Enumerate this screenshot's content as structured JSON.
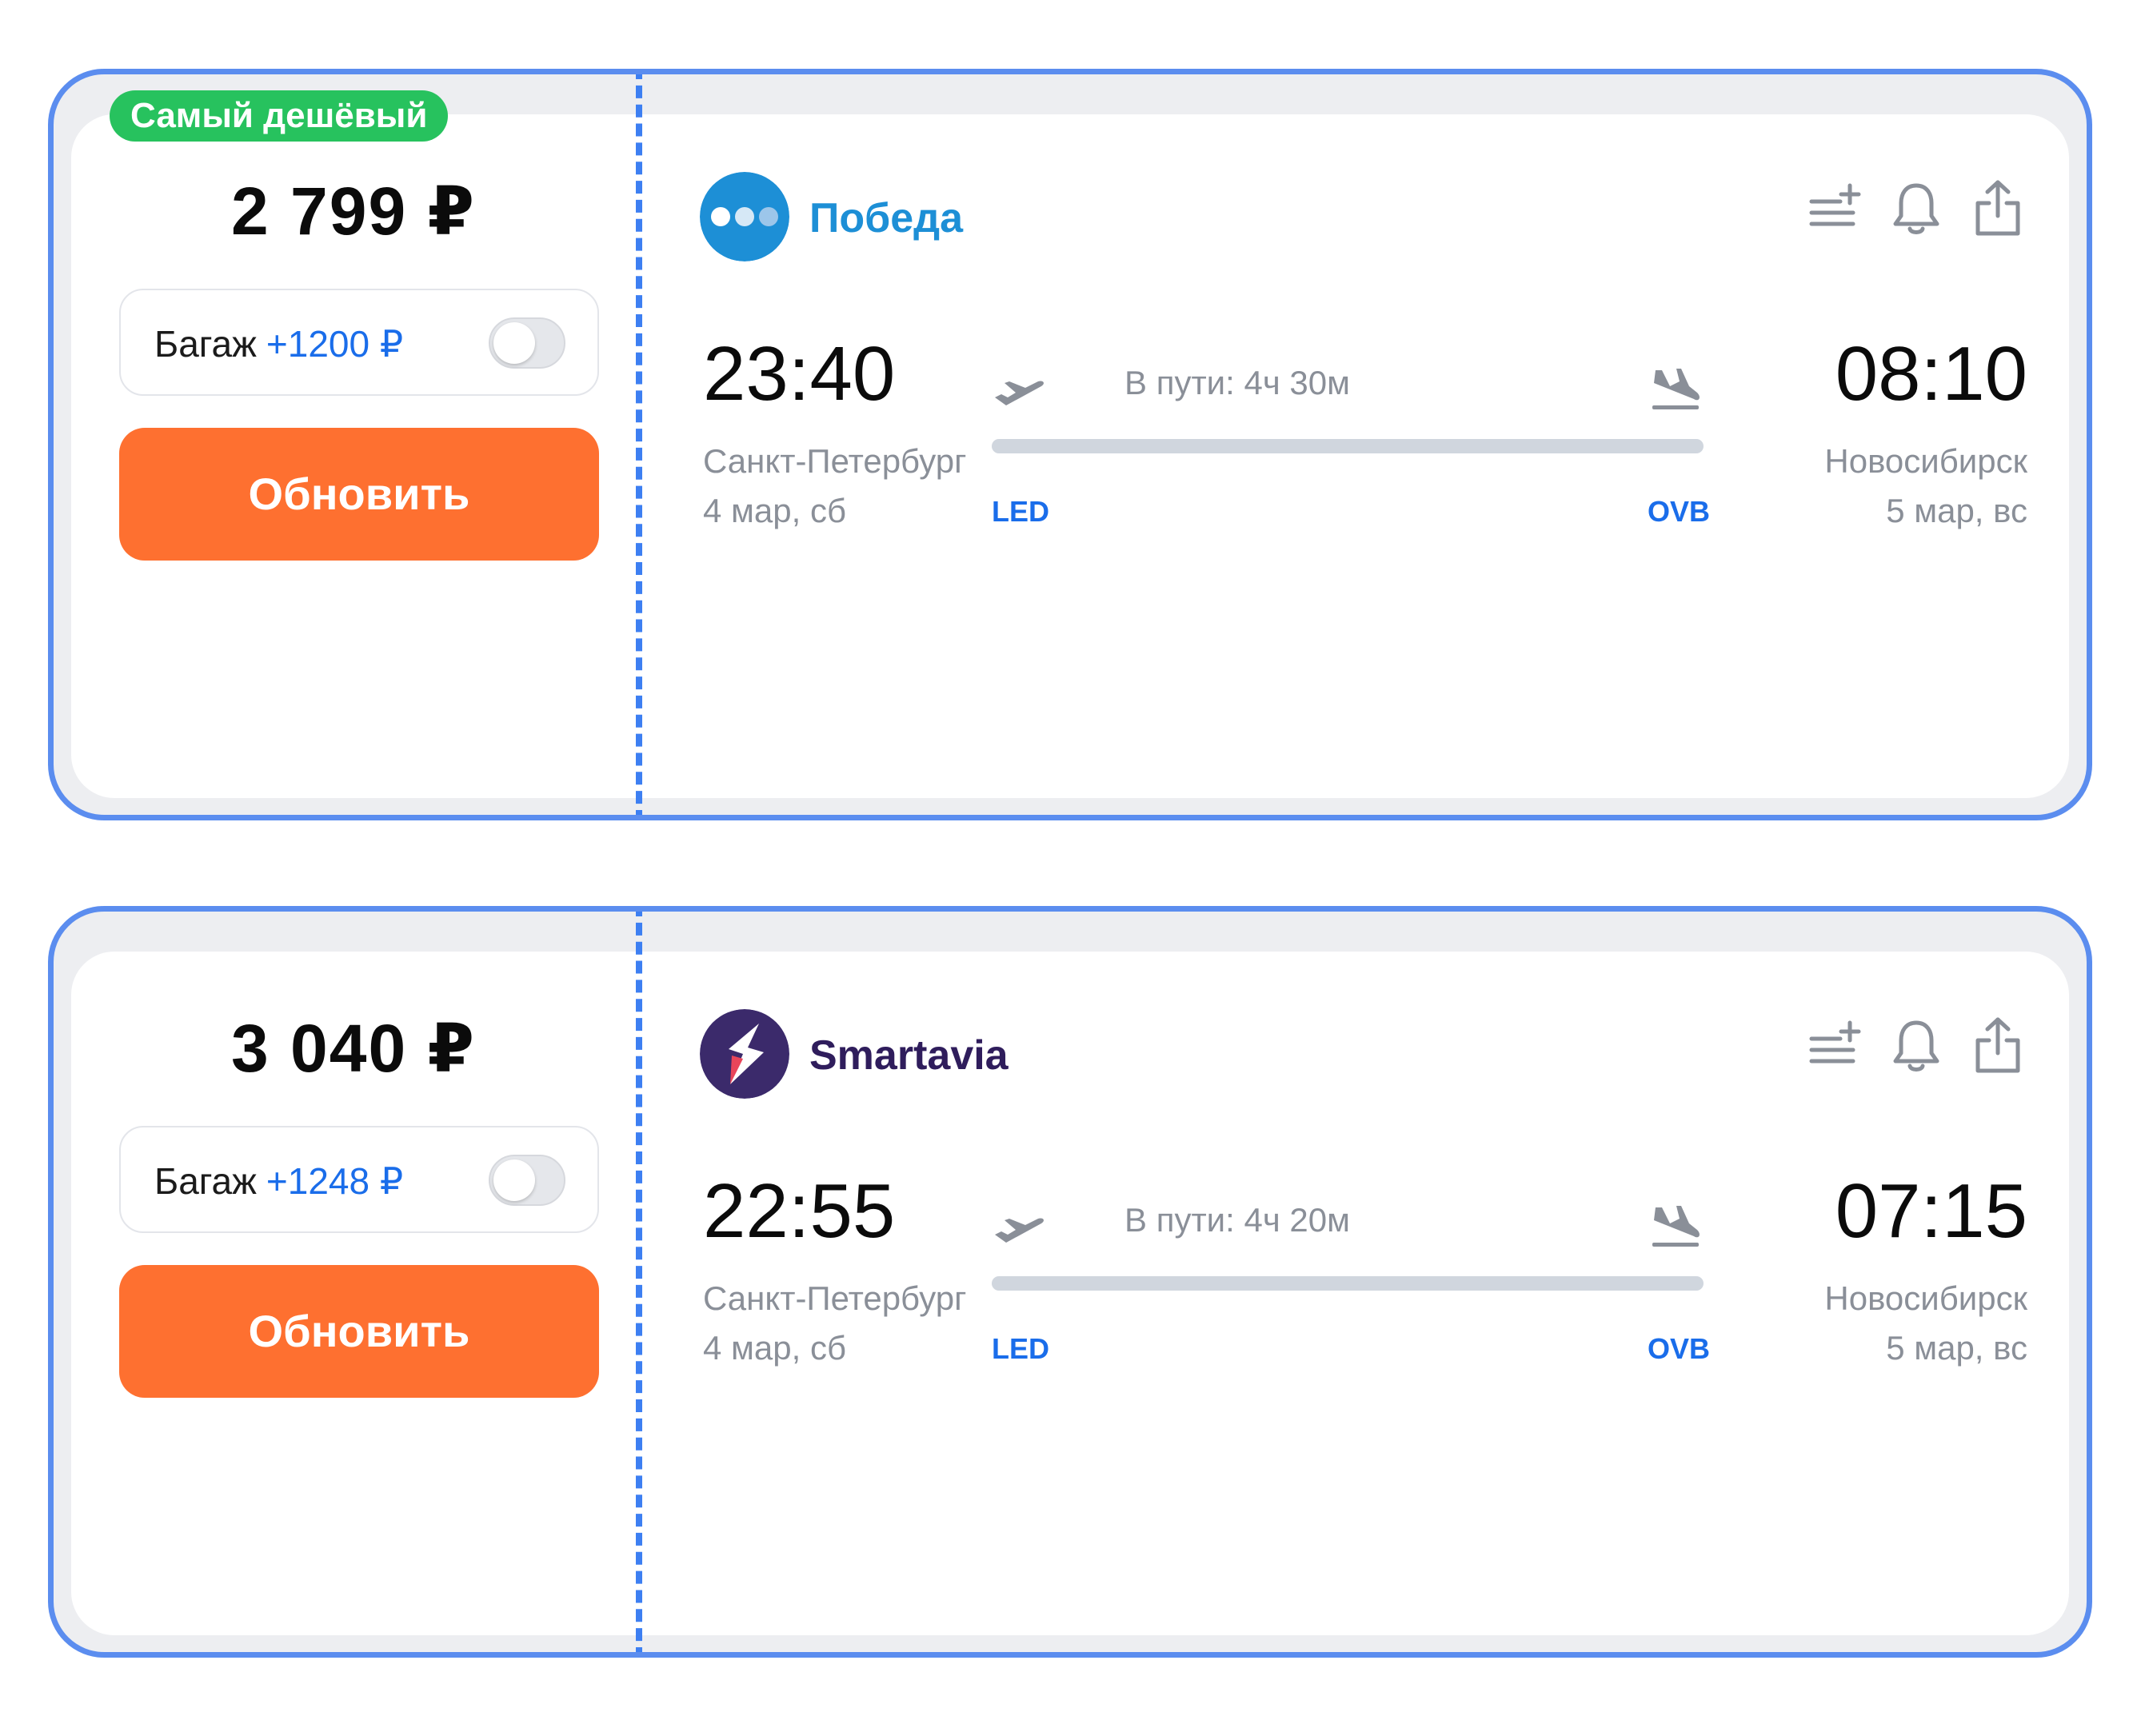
{
  "offers": [
    {
      "badge": "Самый дешёвый",
      "price": "2 799 ₽",
      "baggage_label": "Багаж",
      "baggage_price": "+1200 ₽",
      "baggage_enabled": false,
      "button_label": "Обновить",
      "airline": {
        "name": "Победа",
        "name_color": "#1d8fd6",
        "logo_icon": "pobeda-logo-icon",
        "logo_color": "#1d8fd6"
      },
      "departure": {
        "time": "23:40",
        "city": "Санкт-Петербург",
        "date": "4 мар, сб",
        "code": "LED"
      },
      "arrival": {
        "time": "08:10",
        "city": "Новосибирск",
        "date": "5 мар, вс",
        "code": "OVB"
      },
      "duration": "В пути: 4ч 30м"
    },
    {
      "badge": "",
      "price": "3 040 ₽",
      "baggage_label": "Багаж",
      "baggage_price": "+1248 ₽",
      "baggage_enabled": false,
      "button_label": "Обновить",
      "airline": {
        "name": "Smartavia",
        "name_color": "#2f1d5c",
        "logo_icon": "smartavia-logo-icon",
        "logo_color": "#3b2a6b"
      },
      "departure": {
        "time": "22:55",
        "city": "Санкт-Петербург",
        "date": "4 мар, сб",
        "code": "LED"
      },
      "arrival": {
        "time": "07:15",
        "city": "Новосибирск",
        "date": "5 мар, вс",
        "code": "OVB"
      },
      "duration": "В пути: 4ч 20м"
    }
  ],
  "colors": {
    "card_border": "#5b8def",
    "badge_bg": "#27c25e",
    "button_bg": "#fe7030",
    "accent_blue": "#1a6dea"
  },
  "icons": [
    "add-to-list-icon",
    "bell-icon",
    "share-icon",
    "takeoff-icon",
    "landing-icon"
  ]
}
